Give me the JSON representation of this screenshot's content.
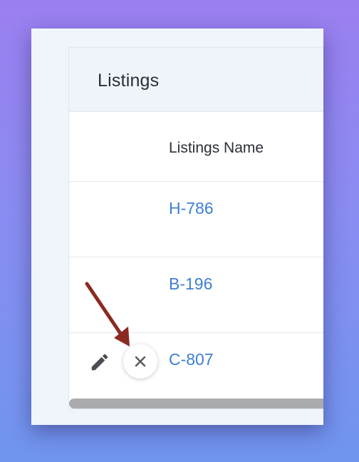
{
  "card": {
    "title": "Listings",
    "column_header": "Listings Name"
  },
  "rows": [
    {
      "name": "H-786"
    },
    {
      "name": "B-196"
    },
    {
      "name": "C-807"
    }
  ],
  "row_actions": {
    "edit_icon": "pencil-icon",
    "delete_icon": "close-icon"
  },
  "colors": {
    "link": "#3e7fd0",
    "annotation_arrow": "#8b2a22",
    "background_top": "#9b7ff0",
    "background_bottom": "#6f95ee"
  }
}
